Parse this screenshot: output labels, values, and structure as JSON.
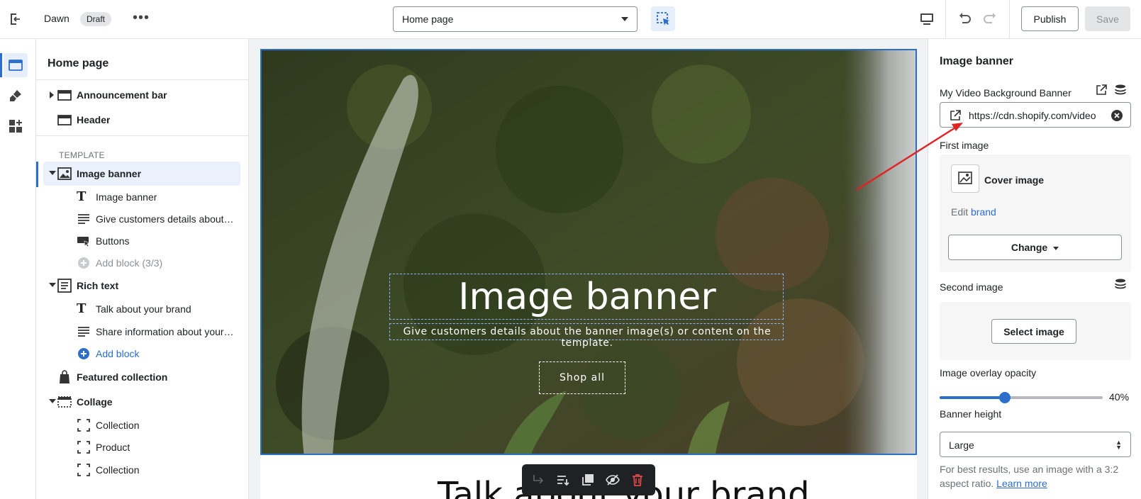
{
  "topbar": {
    "theme_name": "Dawn",
    "status_badge": "Draft",
    "template_select": "Home page",
    "publish_label": "Publish",
    "save_label": "Save"
  },
  "left_panel": {
    "title": "Home page",
    "header_sections": [
      {
        "label": "Announcement bar",
        "icon": "section-icon",
        "collapsed": true
      },
      {
        "label": "Header",
        "icon": "section-icon"
      }
    ],
    "template_label": "TEMPLATE",
    "sections": [
      {
        "label": "Image banner",
        "icon": "image-icon",
        "expanded": true,
        "selected": true,
        "blocks": [
          {
            "label": "Image banner",
            "icon": "text-icon"
          },
          {
            "label": "Give customers details about…",
            "icon": "paragraph-icon"
          },
          {
            "label": "Buttons",
            "icon": "button-icon"
          },
          {
            "label": "Add block (3/3)",
            "icon": "add-icon",
            "disabled": true
          }
        ]
      },
      {
        "label": "Rich text",
        "icon": "richtext-icon",
        "expanded": true,
        "blocks": [
          {
            "label": "Talk about your brand",
            "icon": "text-icon"
          },
          {
            "label": "Share information about your…",
            "icon": "paragraph-icon"
          },
          {
            "label": "Add block",
            "icon": "add-icon",
            "link": true
          }
        ]
      },
      {
        "label": "Featured collection",
        "icon": "collection-icon"
      },
      {
        "label": "Collage",
        "icon": "collage-icon",
        "expanded": true,
        "blocks": [
          {
            "label": "Collection",
            "icon": "block-frame-icon"
          },
          {
            "label": "Product",
            "icon": "block-frame-icon"
          },
          {
            "label": "Collection",
            "icon": "block-frame-icon"
          }
        ]
      }
    ]
  },
  "preview": {
    "banner_title": "Image banner",
    "banner_subtitle": "Give customers details about the banner image(s) or content on the template.",
    "banner_button": "Shop all",
    "next_heading": "Talk about your brand"
  },
  "right_panel": {
    "title": "Image banner",
    "video_label": "My Video Background Banner",
    "video_url": "https://cdn.shopify.com/videos/",
    "first_image_label": "First image",
    "cover_label": "Cover image",
    "edit_prefix": "Edit",
    "edit_link": "brand",
    "change_label": "Change",
    "second_image_label": "Second image",
    "select_image_label": "Select image",
    "overlay_label": "Image overlay opacity",
    "overlay_value": 40,
    "overlay_value_text": "40%",
    "height_label": "Banner height",
    "height_value": "Large",
    "help_text": "For best results, use an image with a 3:2 aspect ratio.",
    "help_link": "Learn more"
  },
  "colors": {
    "accent": "#2c6ecb",
    "annotation_arrow": "#e02424",
    "delete_icon": "#e04848"
  }
}
